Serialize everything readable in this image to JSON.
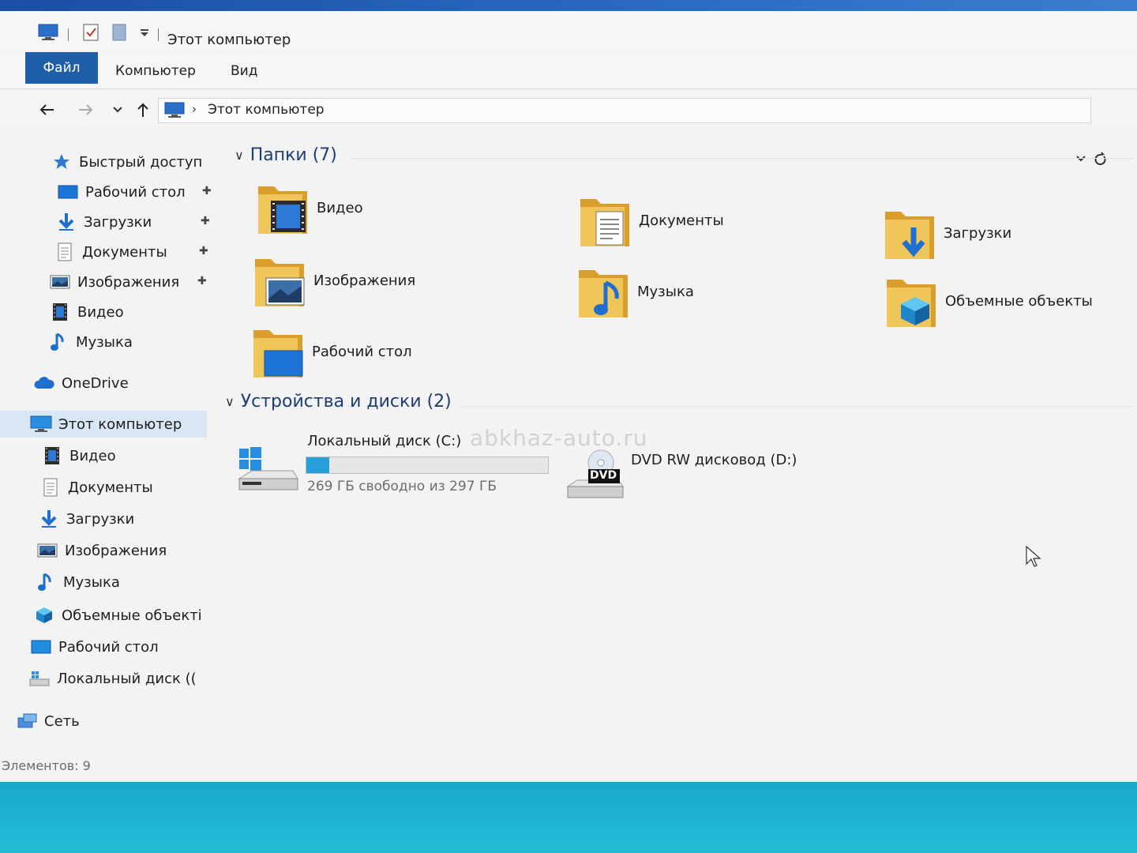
{
  "window": {
    "title": "Этот компьютер"
  },
  "ribbon": {
    "tabs": [
      "Файл",
      "Компьютер",
      "Вид"
    ]
  },
  "address": {
    "crumb": "Этот компьютер",
    "separator": "›"
  },
  "sidebar": {
    "quick_access": {
      "label": "Быстрый доступ",
      "items": [
        {
          "label": "Рабочий стол",
          "icon": "desktop-icon",
          "pinned": true
        },
        {
          "label": "Загрузки",
          "icon": "download-icon",
          "pinned": true
        },
        {
          "label": "Документы",
          "icon": "document-icon",
          "pinned": true
        },
        {
          "label": "Изображения",
          "icon": "pictures-icon",
          "pinned": true
        },
        {
          "label": "Видео",
          "icon": "video-icon",
          "pinned": false
        },
        {
          "label": "Музыка",
          "icon": "music-icon",
          "pinned": false
        }
      ]
    },
    "onedrive": {
      "label": "OneDrive"
    },
    "this_pc": {
      "label": "Этот компьютер",
      "items": [
        {
          "label": "Видео",
          "icon": "video-icon"
        },
        {
          "label": "Документы",
          "icon": "document-icon"
        },
        {
          "label": "Загрузки",
          "icon": "download-icon"
        },
        {
          "label": "Изображения",
          "icon": "pictures-icon"
        },
        {
          "label": "Музыка",
          "icon": "music-icon"
        },
        {
          "label": "Объемные объекті",
          "icon": "3d-objects-icon"
        },
        {
          "label": "Рабочий стол",
          "icon": "desktop-icon"
        },
        {
          "label": "Локальный диск ((",
          "icon": "drive-icon"
        }
      ]
    },
    "network": {
      "label": "Сеть"
    }
  },
  "main": {
    "folders_group": {
      "title": "Папки (7)",
      "items": [
        {
          "label": "Видео",
          "icon": "video-folder-icon"
        },
        {
          "label": "Документы",
          "icon": "documents-folder-icon"
        },
        {
          "label": "Загрузки",
          "icon": "downloads-folder-icon"
        },
        {
          "label": "Изображения",
          "icon": "pictures-folder-icon"
        },
        {
          "label": "Музыка",
          "icon": "music-folder-icon"
        },
        {
          "label": "Объемные объекты",
          "icon": "3d-objects-folder-icon"
        },
        {
          "label": "Рабочий стол",
          "icon": "desktop-folder-icon"
        }
      ]
    },
    "devices_group": {
      "title": "Устройства и диски (2)",
      "drives": [
        {
          "label": "Локальный диск (C:)",
          "free_text": "269 ГБ свободно из 297 ГБ",
          "used_fraction": 0.094
        },
        {
          "label": "DVD RW дисковод (D:)",
          "badge": "DVD"
        }
      ]
    }
  },
  "watermark": "abkhaz-auto.ru",
  "status": {
    "items_text": "Элементов: 9"
  },
  "colors": {
    "accent": "#1f5ea8",
    "selection": "#d9e6f4",
    "folder": "#e8b84a",
    "drive_fill": "#26a0da"
  }
}
